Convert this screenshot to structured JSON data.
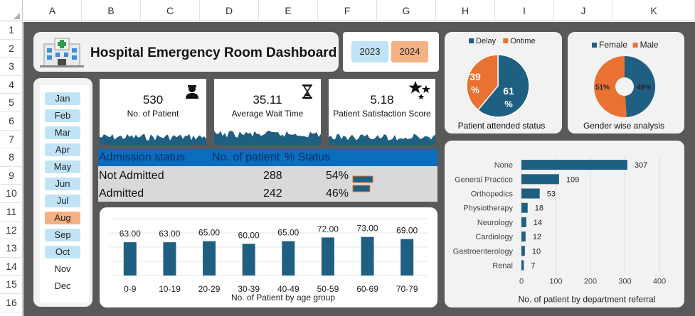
{
  "spreadsheet": {
    "columns": [
      "A",
      "B",
      "C",
      "D",
      "E",
      "F",
      "G",
      "H",
      "I",
      "J",
      "K"
    ],
    "rows": [
      "1",
      "2",
      "3",
      "4",
      "5",
      "6",
      "7",
      "8",
      "9",
      "10",
      "11",
      "12",
      "13",
      "14",
      "15",
      "16"
    ]
  },
  "dashboard": {
    "title": "Hospital Emergency Room Dashboard",
    "title_icon": "hospital-icon",
    "years": [
      {
        "label": "2023",
        "selected": false
      },
      {
        "label": "2024",
        "selected": true
      }
    ],
    "months": [
      {
        "label": "Jan",
        "state": "available"
      },
      {
        "label": "Feb",
        "state": "available"
      },
      {
        "label": "Mar",
        "state": "available"
      },
      {
        "label": "Apr",
        "state": "available"
      },
      {
        "label": "May",
        "state": "available"
      },
      {
        "label": "Jun",
        "state": "available"
      },
      {
        "label": "Jul",
        "state": "available"
      },
      {
        "label": "Aug",
        "state": "selected"
      },
      {
        "label": "Sep",
        "state": "available"
      },
      {
        "label": "Oct",
        "state": "available"
      },
      {
        "label": "Nov",
        "state": "empty"
      },
      {
        "label": "Dec",
        "state": "empty"
      }
    ],
    "colors": {
      "accent_blue": "#1f5f82",
      "accent_orange": "#e97132",
      "slicer_blue": "#c0e4f5",
      "slicer_orange": "#f4b183",
      "header_blue": "#0a6dbd",
      "canvas_gray": "#595959"
    },
    "kpis": [
      {
        "value": "530",
        "label": "No. of Patient",
        "icon": "person-icon"
      },
      {
        "value": "35.11",
        "label": "Average Wait Time",
        "icon": "hourglass-icon"
      },
      {
        "value": "5.18",
        "label": "Patient Satisfaction Score",
        "icon": "stars-icon"
      }
    ],
    "admission": {
      "headers": [
        "Admission status",
        "No. of patient",
        "% Status"
      ],
      "rows": [
        {
          "status": "Not Admitted",
          "count": "288",
          "pct": "54%",
          "share": 0.54
        },
        {
          "status": "Admitted",
          "count": "242",
          "pct": "46%",
          "share": 0.46
        }
      ]
    }
  },
  "chart_data": [
    {
      "type": "bar",
      "title": "",
      "xlabel": "No. of Patient by age group",
      "categories": [
        "0-9",
        "10-19",
        "20-29",
        "30-39",
        "40-49",
        "50-59",
        "60-69",
        "70-79"
      ],
      "values": [
        63,
        63,
        65,
        60,
        65,
        72,
        73,
        69
      ],
      "data_labels": [
        "63.00",
        "63.00",
        "65.00",
        "60.00",
        "65.00",
        "72.00",
        "73.00",
        "69.00"
      ],
      "color": "#1f5f82"
    },
    {
      "type": "pie",
      "title": "Patient attended status",
      "legend": [
        "Delay",
        "Ontime"
      ],
      "legend_position": "top",
      "values": [
        61,
        39
      ],
      "labels": [
        "61 %",
        "39 %"
      ],
      "colors": [
        "#1f5f82",
        "#e97132"
      ]
    },
    {
      "type": "pie",
      "title": "Gender wise analysis",
      "legend": [
        "Female",
        "Male"
      ],
      "legend_position": "top",
      "values": [
        49,
        51
      ],
      "labels": [
        "49%",
        "51%"
      ],
      "donut": true,
      "colors": [
        "#1f5f82",
        "#e97132"
      ]
    },
    {
      "type": "bar",
      "orientation": "horizontal",
      "xlabel": "No. of patient by department referral",
      "categories": [
        "None",
        "General Practice",
        "Orthopedics",
        "Physiotherapy",
        "Neurology",
        "Cardiology",
        "Gastroenterology",
        "Renal"
      ],
      "values": [
        307,
        109,
        53,
        18,
        14,
        12,
        10,
        7
      ],
      "xlim": [
        0,
        400
      ],
      "xticks": [
        0,
        100,
        200,
        300,
        400
      ],
      "grid": true,
      "color": "#1f5f82"
    }
  ]
}
